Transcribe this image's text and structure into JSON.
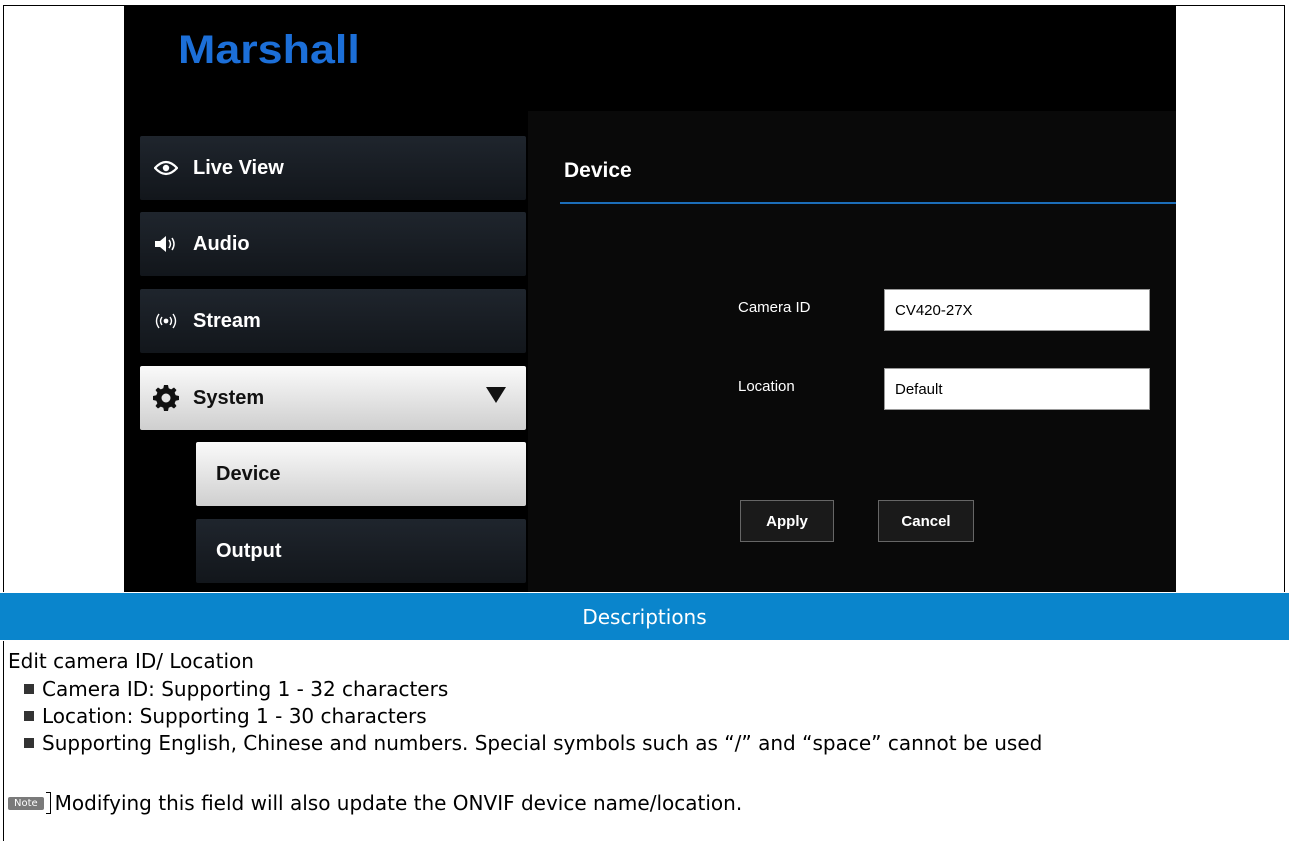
{
  "screenshot": {
    "logo": "Marshall",
    "menu": [
      {
        "label": "Live View",
        "icon": "eye-icon"
      },
      {
        "label": "Audio",
        "icon": "speaker-icon"
      },
      {
        "label": "Stream",
        "icon": "broadcast-icon"
      },
      {
        "label": "System",
        "icon": "gear-icon",
        "selected": true
      }
    ],
    "submenu": [
      {
        "label": "Device",
        "selected": true
      },
      {
        "label": "Output"
      }
    ],
    "panel": {
      "title": "Device",
      "camera_id_label": "Camera ID",
      "camera_id_value": "CV420-27X",
      "location_label": "Location",
      "location_value": "Default",
      "apply_label": "Apply",
      "cancel_label": "Cancel"
    }
  },
  "descriptions": {
    "header": "Descriptions",
    "intro": "Edit camera ID/ Location",
    "bullets": [
      "Camera ID: Supporting 1 - 32 characters",
      "Location: Supporting 1 - 30 characters",
      "Supporting English, Chinese and numbers. Special symbols such as “/” and “space” cannot be used"
    ],
    "note_tag": "Note",
    "note_text": "Modifying this field will also update the ONVIF device name/location."
  },
  "colors": {
    "brand_blue": "#1c6fd8",
    "header_bar": "#0a85cc",
    "panel_rule": "#1c6db8"
  }
}
